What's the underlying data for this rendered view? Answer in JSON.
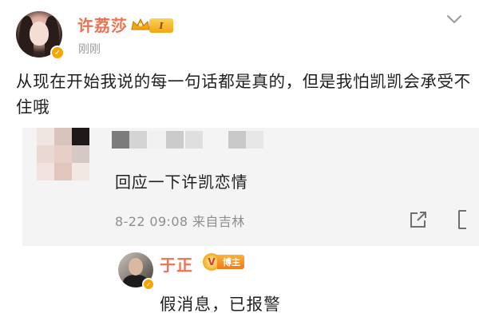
{
  "post": {
    "author": {
      "name": "许荔莎",
      "level": "I",
      "verified": true
    },
    "time": "刚刚",
    "text": "从现在开始我说的每一句话都是真的，但是我怕凯凯会承受不住哦"
  },
  "quote": {
    "text": "回应一下许凯恋情",
    "meta": "8-22 09:08 来自吉林"
  },
  "reply": {
    "author": {
      "name": "于正",
      "badge": "博主",
      "verified": true
    },
    "text": "假消息，已报警"
  },
  "colors": {
    "username": "#eb7350",
    "muted": "#9a9a9a",
    "card_bg": "#f4f4f4",
    "verified": "#f7a600"
  },
  "icons": {
    "more": "chevron-down-icon",
    "share": "share-icon",
    "crown": "crown-icon"
  }
}
